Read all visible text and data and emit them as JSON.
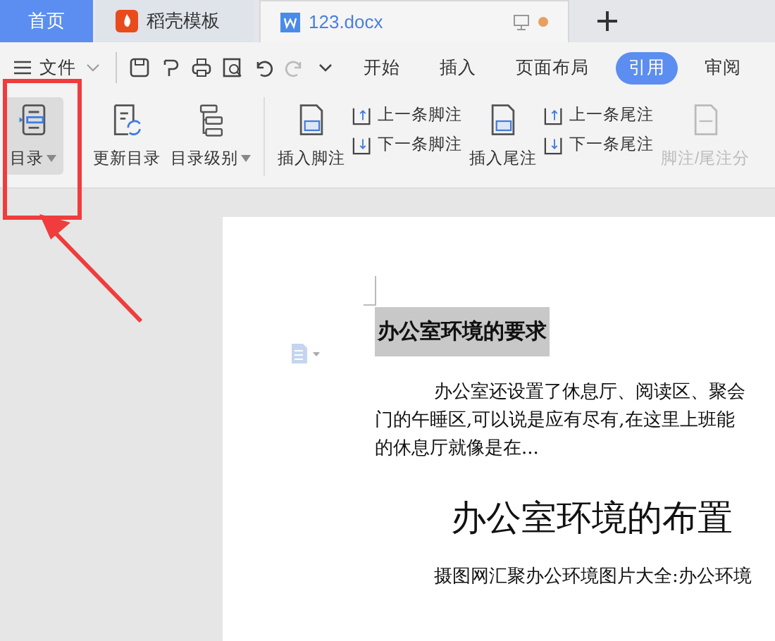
{
  "tabs": [
    {
      "kind": "home",
      "label": "首页",
      "selected": false
    },
    {
      "kind": "template",
      "label": "稻壳模板",
      "selected": false
    },
    {
      "kind": "document",
      "label": "123.docx",
      "selected": true
    }
  ],
  "menu": {
    "file_label": "文件",
    "ribbon_tabs": [
      {
        "label": "开始",
        "selected": false
      },
      {
        "label": "插入",
        "selected": false
      },
      {
        "label": "页面布局",
        "selected": false
      },
      {
        "label": "引用",
        "selected": true
      },
      {
        "label": "审阅",
        "selected": false
      }
    ]
  },
  "ribbon": [
    {
      "kind": "big",
      "label": "目录",
      "caret": true,
      "selected": true,
      "disabled": false
    },
    {
      "kind": "big",
      "label": "更新目录",
      "caret": false,
      "selected": false,
      "disabled": false
    },
    {
      "kind": "big",
      "label": "目录级别",
      "caret": true,
      "selected": false,
      "disabled": false
    },
    {
      "kind": "separator"
    },
    {
      "kind": "big",
      "label": "插入脚注",
      "caret": false,
      "selected": false,
      "disabled": false
    },
    {
      "kind": "pair",
      "items": [
        {
          "label": "上一条脚注"
        },
        {
          "label": "下一条脚注"
        }
      ]
    },
    {
      "kind": "big",
      "label": "插入尾注",
      "caret": false,
      "selected": false,
      "disabled": false
    },
    {
      "kind": "pair",
      "items": [
        {
          "label": "上一条尾注"
        },
        {
          "label": "下一条尾注"
        }
      ]
    },
    {
      "kind": "big",
      "label": "脚注/尾注分",
      "caret": false,
      "selected": false,
      "disabled": true
    }
  ],
  "document": {
    "heading": "办公室环境的要求",
    "paragraph_1": [
      "办公室还设置了休息厅、阅读区、聚会",
      "门的午睡区,可以说是应有尽有,在这里上班能",
      "的休息厅就像是在..."
    ],
    "title": "办公室环境的布置",
    "paragraph_2": [
      "摄图网汇聚办公环境图片大全:办公环境"
    ]
  }
}
